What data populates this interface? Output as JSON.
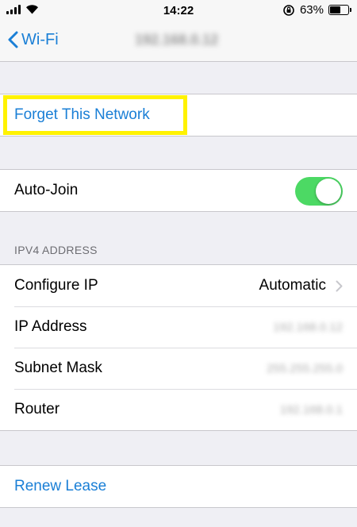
{
  "status_bar": {
    "time": "14:22",
    "battery": "63%",
    "battery_level": 0.63
  },
  "nav": {
    "back_label": "Wi-Fi",
    "title": "192.168.0.12"
  },
  "actions": {
    "forget_label": "Forget This Network",
    "renew_label": "Renew Lease"
  },
  "auto_join": {
    "label": "Auto-Join",
    "enabled": true
  },
  "ipv4": {
    "header": "IPV4 ADDRESS",
    "configure_ip_label": "Configure IP",
    "configure_ip_value": "Automatic",
    "ip_address_label": "IP Address",
    "ip_address_value": "192.168.0.12",
    "subnet_mask_label": "Subnet Mask",
    "subnet_mask_value": "255.255.255.0",
    "router_label": "Router",
    "router_value": "192.168.0.1"
  },
  "colors": {
    "accent": "#1a7fd6",
    "toggle_on": "#4cd964",
    "highlight": "#fff200",
    "background": "#efeff4"
  }
}
